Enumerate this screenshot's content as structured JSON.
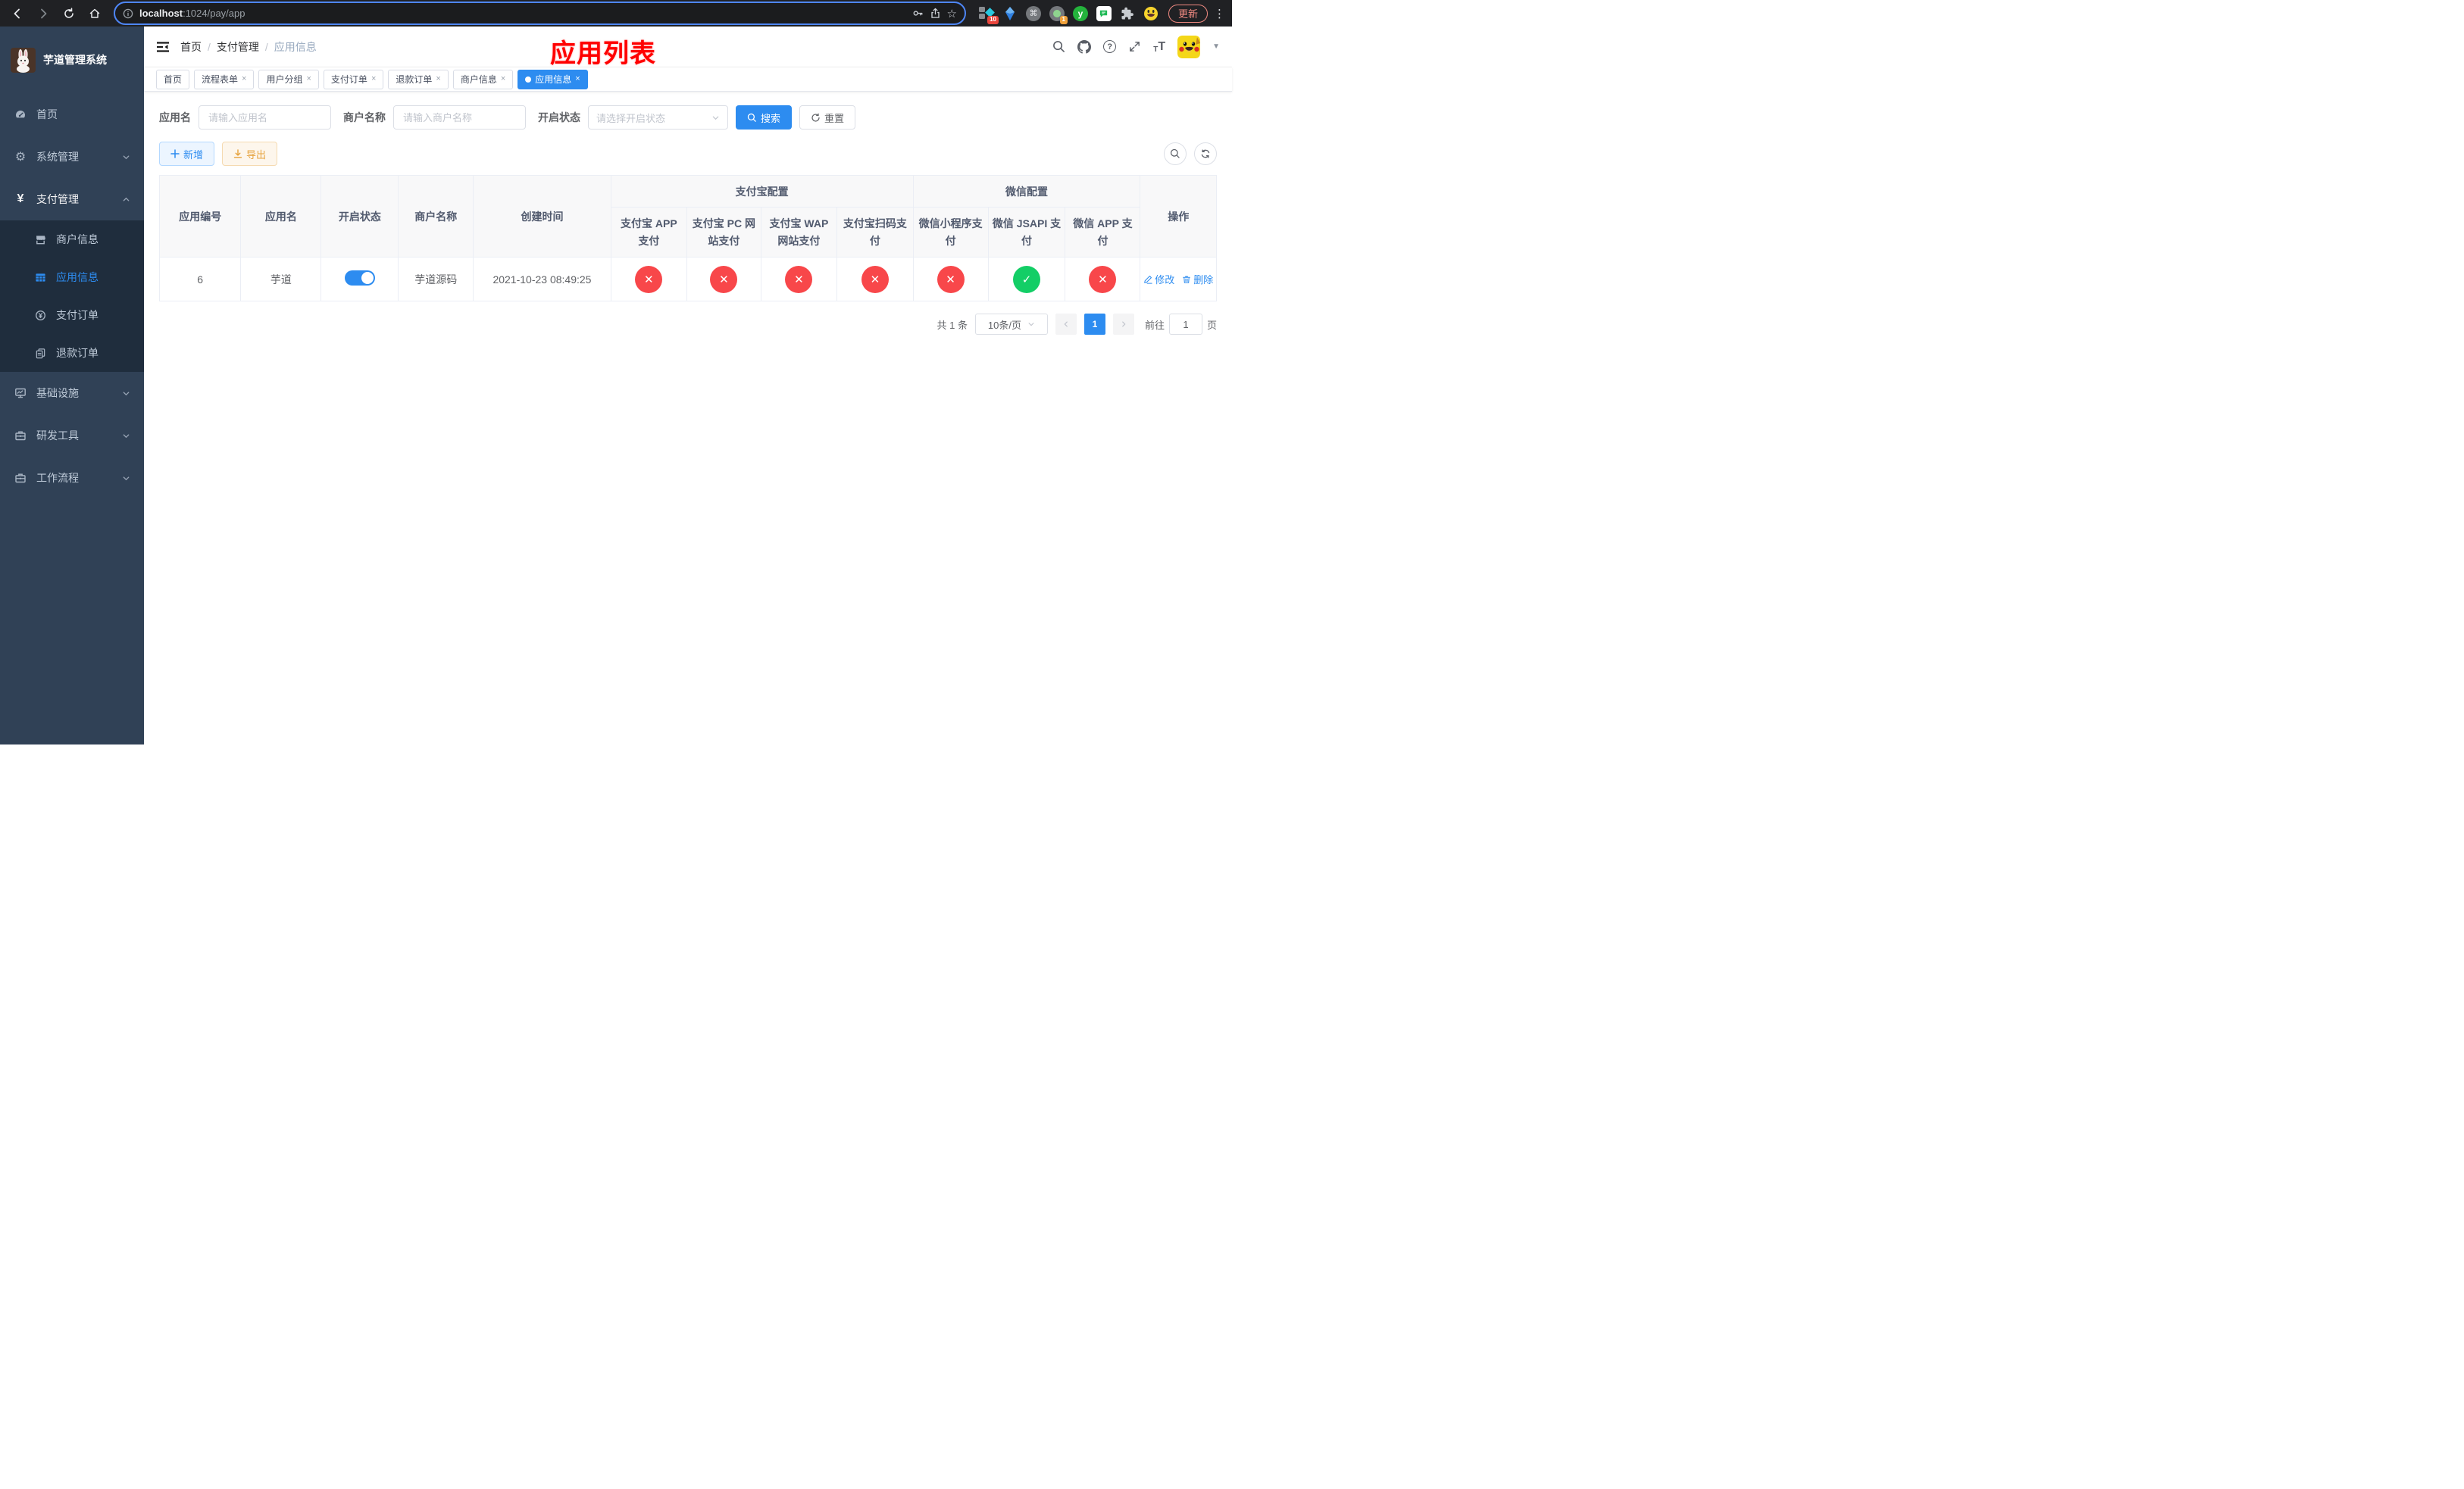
{
  "browser": {
    "url_domain": "localhost",
    "url_path": ":1024/pay/app",
    "update_label": "更新",
    "badge_ten": "10",
    "badge_one": "1",
    "ext_y_label": "y",
    "cmd_glyph": "⌘",
    "dots_glyph": "⋮",
    "star_glyph": "☆"
  },
  "sidebar": {
    "title": "芋道管理系统",
    "menu": [
      {
        "label": "首页"
      },
      {
        "label": "系统管理"
      },
      {
        "label": "支付管理"
      },
      {
        "label": "基础设施"
      },
      {
        "label": "研发工具"
      },
      {
        "label": "工作流程"
      }
    ],
    "submenu": [
      {
        "label": "商户信息"
      },
      {
        "label": "应用信息"
      },
      {
        "label": "支付订单"
      },
      {
        "label": "退款订单"
      }
    ]
  },
  "header": {
    "breadcrumb": [
      "首页",
      "支付管理",
      "应用信息"
    ],
    "separator": "/",
    "annotation": "应用列表"
  },
  "tabs": [
    {
      "label": "首页"
    },
    {
      "label": "流程表单"
    },
    {
      "label": "用户分组"
    },
    {
      "label": "支付订单"
    },
    {
      "label": "退款订单"
    },
    {
      "label": "商户信息"
    },
    {
      "label": "应用信息"
    }
  ],
  "close_glyph": "×",
  "filters": {
    "app_name_label": "应用名",
    "app_name_placeholder": "请输入应用名",
    "merchant_label": "商户名称",
    "merchant_placeholder": "请输入商户名称",
    "status_label": "开启状态",
    "status_placeholder": "请选择开启状态",
    "search_label": "搜索",
    "reset_label": "重置"
  },
  "toolbar": {
    "add_label": "新增",
    "export_label": "导出"
  },
  "table": {
    "columns": {
      "app_id": "应用编号",
      "app_name": "应用名",
      "status": "开启状态",
      "merchant": "商户名称",
      "create_time": "创建时间",
      "alipay_group": "支付宝配置",
      "wechat_group": "微信配置",
      "alipay_app": "支付宝 APP 支付",
      "alipay_pc": "支付宝 PC 网站支付",
      "alipay_wap": "支付宝 WAP 网站支付",
      "alipay_qr": "支付宝扫码支付",
      "wx_mini": "微信小程序支付",
      "wx_jsapi": "微信 JSAPI 支付",
      "wx_app": "微信 APP 支付",
      "actions": "操作"
    },
    "row": {
      "app_id": "6",
      "app_name": "芋道",
      "switch_state": "on",
      "merchant": "芋道源码",
      "create_time": "2021-10-23 08:49:25",
      "statuses": [
        "no",
        "no",
        "no",
        "no",
        "no",
        "yes",
        "no"
      ],
      "edit_label": "修改",
      "delete_label": "删除"
    }
  },
  "pagination": {
    "total_label": "共 1 条",
    "page_size": "10条/页",
    "current_page": "1",
    "goto_label": "前往",
    "goto_value": "1",
    "page_suffix": "页"
  },
  "colors": {
    "accent": "#2d8cf0",
    "success": "#13ce66",
    "danger": "#f8474a",
    "warning": "#e6a23c",
    "sidebar_bg": "#304156",
    "submenu_bg": "#1f2d3d",
    "annotation": "#ff0000",
    "update_pill": "#f28b82"
  }
}
